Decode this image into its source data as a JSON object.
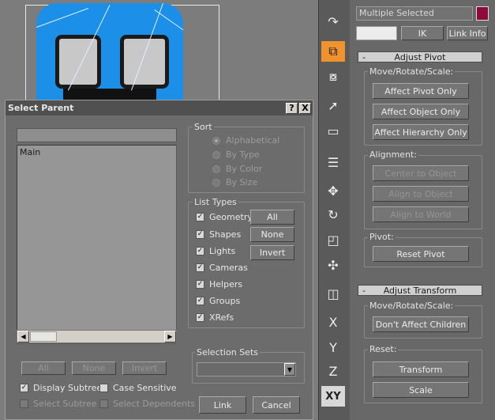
{
  "command_panel": {
    "selection_name": "Multiple Selected",
    "selection_color": "#8c0a3c",
    "ik_button": "IK",
    "link_info_button": "Link Info",
    "adjust_pivot": {
      "title": "Adjust Pivot",
      "collapse": "-",
      "move_rotate_scale_label": "Move/Rotate/Scale:",
      "affect_pivot_only": "Affect Pivot Only",
      "affect_object_only": "Affect Object Only",
      "affect_hierarchy_only": "Affect Hierarchy Only",
      "alignment_label": "Alignment:",
      "center_to_object": "Center to Object",
      "align_to_object": "Align to Object",
      "align_to_world": "Align to World",
      "pivot_label": "Pivot:",
      "reset_pivot": "Reset Pivot"
    },
    "adjust_transform": {
      "title": "Adjust Transform",
      "collapse": "-",
      "move_rotate_scale_label": "Move/Rotate/Scale:",
      "dont_affect_children": "Don't Affect Children",
      "reset_label": "Reset:",
      "transform": "Transform",
      "scale": "Scale"
    },
    "toolbar": {
      "axis_x": "X",
      "axis_y": "Y",
      "axis_z": "Z",
      "axis_xy": "XY"
    },
    "accent_color": "#f0932f"
  },
  "dialog": {
    "title": "Select Parent",
    "help_button": "?",
    "close_button": "X",
    "search_value": "",
    "list_items": [
      "Main"
    ],
    "sort": {
      "label": "Sort",
      "options": [
        "Alphabetical",
        "By Type",
        "By Color",
        "By Size"
      ],
      "selected": "Alphabetical"
    },
    "list_types": {
      "label": "List Types",
      "items": [
        {
          "label": "Geometry",
          "checked": true
        },
        {
          "label": "Shapes",
          "checked": true
        },
        {
          "label": "Lights",
          "checked": true
        },
        {
          "label": "Cameras",
          "checked": true
        },
        {
          "label": "Helpers",
          "checked": true
        },
        {
          "label": "Groups",
          "checked": true
        },
        {
          "label": "XRefs",
          "checked": true
        }
      ],
      "all_button": "All",
      "none_button": "None",
      "invert_button": "Invert"
    },
    "list_all_button": "All",
    "list_none_button": "None",
    "list_invert_button": "Invert",
    "display_subtree": "Display Subtree",
    "case_sensitive": "Case Sensitive",
    "select_subtree": "Select Subtree",
    "select_dependents": "Select Dependents",
    "selection_sets_label": "Selection Sets",
    "selection_sets_value": "",
    "link_button": "Link",
    "cancel_button": "Cancel"
  }
}
